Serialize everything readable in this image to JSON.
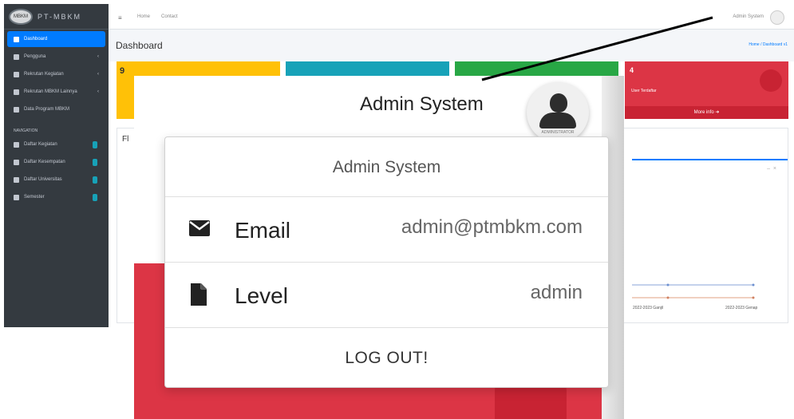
{
  "sidebar": {
    "brand_logo": "MBKM",
    "brand": "PT-MBKM",
    "items": [
      {
        "label": "Dashboard",
        "active": true
      },
      {
        "label": "Pengguna"
      },
      {
        "label": "Rekrutan Kegiatan"
      },
      {
        "label": "Rekrutan MBKM Lainnya"
      },
      {
        "label": "Data Program MBKM"
      }
    ],
    "section_header": "NAVIGATION",
    "section_items": [
      {
        "label": "Daftar Kegiatan"
      },
      {
        "label": "Daftar Kesempatan"
      },
      {
        "label": "Daftar Universitas"
      },
      {
        "label": "Semester"
      }
    ]
  },
  "topbar": {
    "menu_icon": "hamburger-icon",
    "home_link": "Home",
    "contact_link": "Contact",
    "user_name": "Admin System"
  },
  "content": {
    "title": "Dashboard",
    "breadcrumb": "Home / Dashboard v1"
  },
  "tiles": [
    {
      "value": "9",
      "color": "#ffc107"
    },
    {
      "color": "#17a2b8"
    },
    {
      "color": "#28a745"
    },
    {
      "value": "4",
      "label": "User Terdaftar",
      "more": "More info",
      "color": "#dc3545"
    }
  ],
  "chart_card": {
    "title_partial": "Fl",
    "x_ticks": [
      "2022-2023 Ganjil",
      "2022-2023 Genap"
    ]
  },
  "popup": {
    "user_name": "Admin System",
    "avatar_caption": "ADMINISTRATOR",
    "dropdown": {
      "header": "Admin System",
      "rows": [
        {
          "icon": "envelope-icon",
          "label": "Email",
          "value": "admin@ptmbkm.com"
        },
        {
          "icon": "file-icon",
          "label": "Level",
          "value": "admin"
        }
      ],
      "logout": "LOG OUT!"
    }
  },
  "colors": {
    "sidebar": "#343a40",
    "primary": "#007bff",
    "danger": "#dc3545"
  }
}
